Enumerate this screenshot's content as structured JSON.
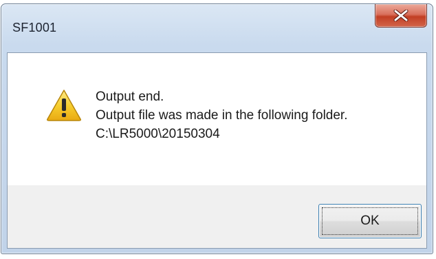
{
  "window": {
    "title": "SF1001",
    "close_icon": "close-icon"
  },
  "dialog": {
    "icon": "warning-icon",
    "message_lines": [
      "Output end.",
      "Output file was made in the following folder.",
      "C:\\LR5000\\20150304"
    ]
  },
  "buttons": {
    "ok_label": "OK"
  },
  "colors": {
    "close_button": "#c94a30",
    "ok_border_focus": "#3c7fb1",
    "warning_fill": "#f5c518"
  }
}
